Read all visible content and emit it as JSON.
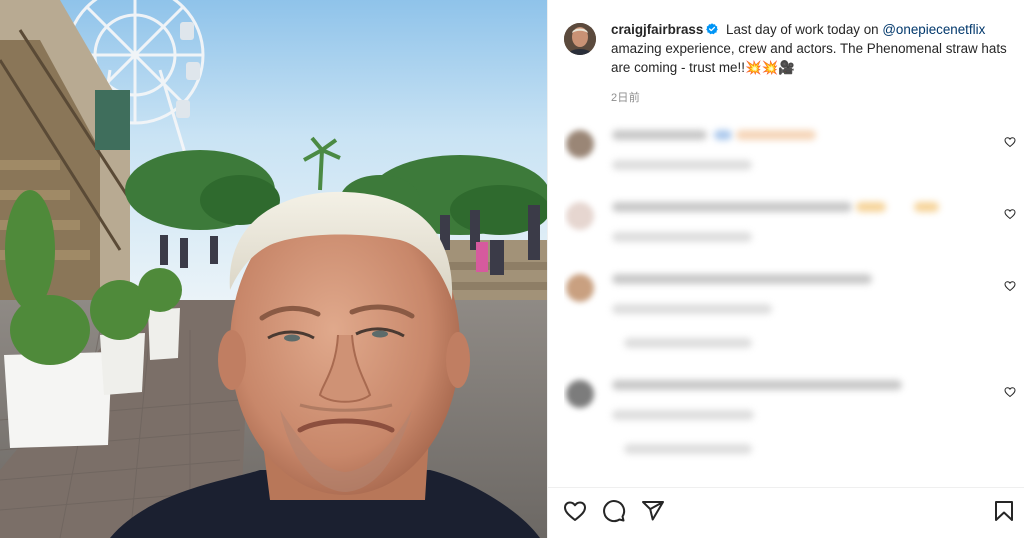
{
  "post": {
    "username": "craigjfairbrass",
    "caption_before": " Last day of work today on ",
    "mention": "@onepiecenetflix",
    "caption_after": " amazing experience, crew and actors. The Phenomenal straw hats are coming - trust me!!💥💥🎥",
    "time": "2日前"
  },
  "comments": [
    {
      "blurred": true
    },
    {
      "blurred": true
    },
    {
      "blurred": true
    },
    {
      "blurred": true
    }
  ],
  "icons": {
    "like": "heart-icon",
    "comment": "comment-icon",
    "share": "share-icon",
    "save": "bookmark-icon",
    "verified": "verified-badge-icon"
  },
  "colors": {
    "verified_blue": "#0095f6",
    "mention": "#00376b",
    "text": "#262626",
    "meta": "#8e8e8e"
  }
}
